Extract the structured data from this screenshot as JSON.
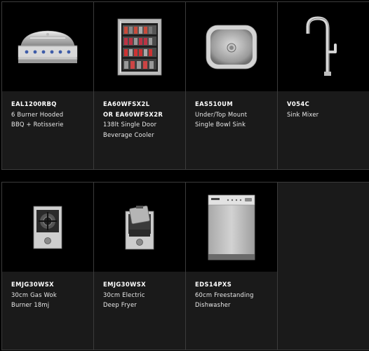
{
  "products_row1": [
    {
      "code_lines": [
        "EAL1200RBQ"
      ],
      "desc_lines": [
        "6 Burner Hooded",
        "BBQ + Rotisserie"
      ],
      "icon": "bbq-icon"
    },
    {
      "code_lines": [
        "EA60WFSX2L",
        "OR EA60WFSX2R"
      ],
      "desc_lines": [
        "138lt Single Door",
        "Beverage Cooler"
      ],
      "icon": "beverage-cooler-icon"
    },
    {
      "code_lines": [
        "EAS510UM"
      ],
      "desc_lines": [
        "Under/Top Mount",
        "Single Bowl Sink"
      ],
      "icon": "sink-icon"
    },
    {
      "code_lines": [
        "V054C"
      ],
      "desc_lines": [
        "Sink Mixer"
      ],
      "icon": "sink-mixer-icon"
    }
  ],
  "products_row2": [
    {
      "code_lines": [
        "EMJG30WSX"
      ],
      "desc_lines": [
        "30cm Gas Wok",
        "Burner 18mj"
      ],
      "icon": "gas-wok-burner-icon"
    },
    {
      "code_lines": [
        "EMJG30WSX"
      ],
      "desc_lines": [
        "30cm Electric",
        "Deep Fryer"
      ],
      "icon": "deep-fryer-icon"
    },
    {
      "code_lines": [
        "EDS14PXS"
      ],
      "desc_lines": [
        "60cm Freestanding",
        "Dishwasher"
      ],
      "icon": "dishwasher-icon"
    }
  ]
}
